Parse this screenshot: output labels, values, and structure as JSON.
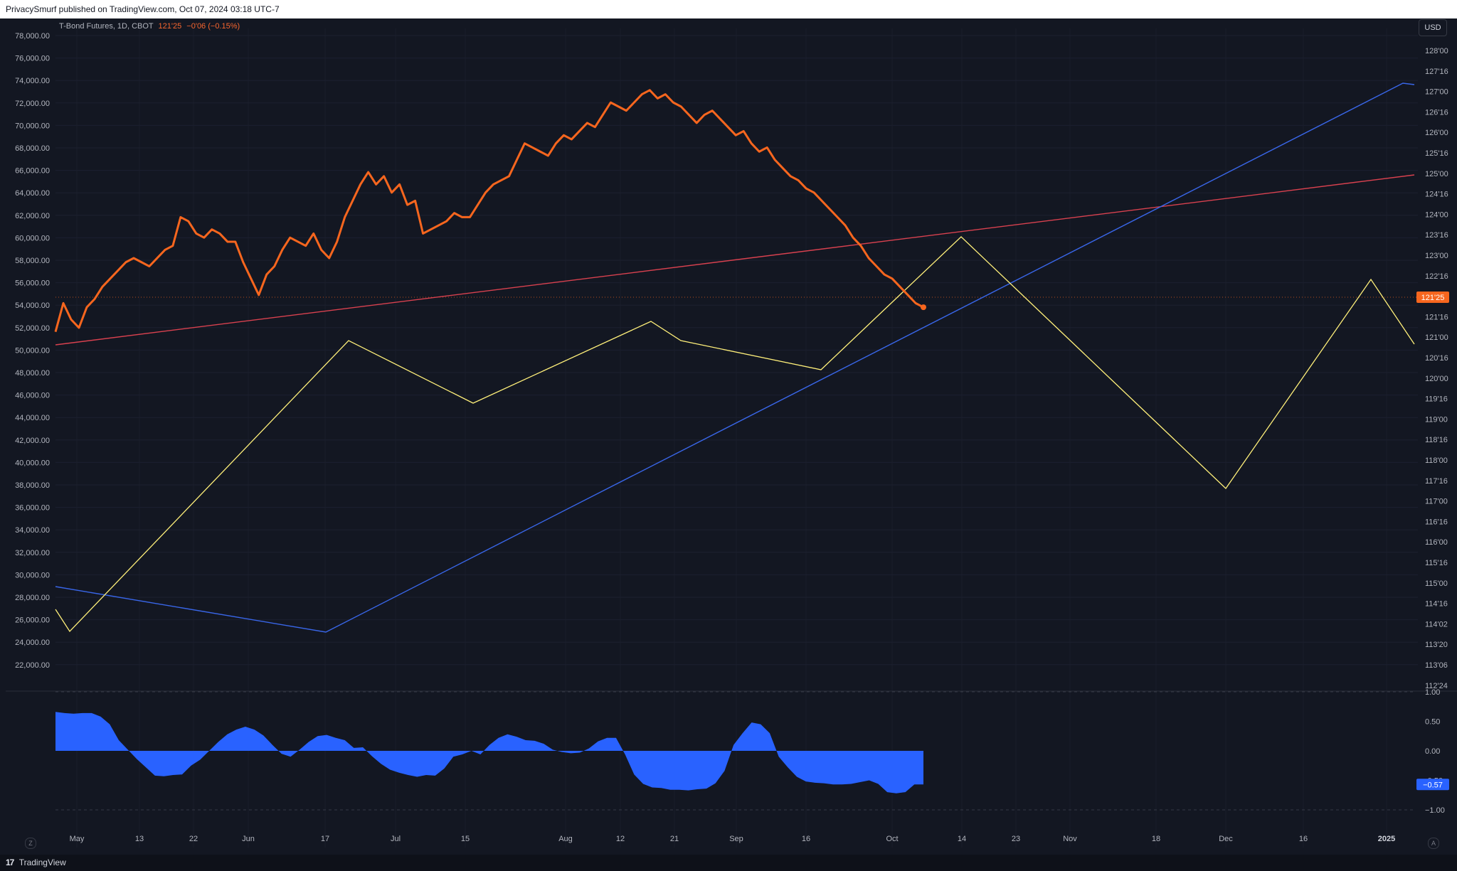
{
  "publisher_bar": "PrivacySmurf published on TradingView.com, Oct 07, 2024 03:18 UTC-7",
  "legend": {
    "symbol": "T-Bond Futures, 1D, CBOT",
    "last": "121'25",
    "change": "−0'06 (−0.15%)"
  },
  "currency_button": "USD",
  "footer": {
    "logo": "17",
    "brand": "TradingView"
  },
  "corner_buttons": {
    "left": "Z",
    "right": "A"
  },
  "colors": {
    "background": "#131722",
    "price_line": "#f7661e",
    "yellow_line": "#fff07a",
    "red_line": "#d9414f",
    "blue_line": "#3966e8",
    "oscillator": "#2962ff"
  },
  "chart_data": {
    "type": "line",
    "time_axis_labels": [
      "May",
      "13",
      "22",
      "Jun",
      "17",
      "Jul",
      "15",
      "Aug",
      "12",
      "21",
      "Sep",
      "16",
      "Oct",
      "14",
      "23",
      "Nov",
      "18",
      "Dec",
      "16",
      "2025"
    ],
    "left_axis": {
      "ticks": [
        "78,000.00",
        "76,000.00",
        "74,000.00",
        "72,000.00",
        "70,000.00",
        "68,000.00",
        "66,000.00",
        "64,000.00",
        "62,000.00",
        "60,000.00",
        "58,000.00",
        "56,000.00",
        "54,000.00",
        "52,000.00",
        "50,000.00",
        "48,000.00",
        "46,000.00",
        "44,000.00",
        "42,000.00",
        "40,000.00",
        "38,000.00",
        "36,000.00",
        "34,000.00",
        "32,000.00",
        "30,000.00",
        "28,000.00",
        "26,000.00",
        "24,000.00",
        "22,000.00"
      ],
      "range": [
        21000,
        79000
      ]
    },
    "right_axis": {
      "ticks": [
        "128'00",
        "127'16",
        "127'00",
        "126'16",
        "126'00",
        "125'16",
        "125'00",
        "124'16",
        "124'00",
        "123'16",
        "123'00",
        "122'16",
        "122'00",
        "121'16",
        "121'00",
        "120'16",
        "120'00",
        "119'16",
        "119'00",
        "118'16",
        "118'00",
        "117'16",
        "117'00",
        "116'16",
        "116'00",
        "115'16",
        "115'00",
        "114'16",
        "114'02",
        "113'20",
        "113'06",
        "112'24"
      ],
      "current_price_label": "121'25"
    },
    "series": [
      {
        "name": "T-Bond Futures",
        "values": [
          [
            0,
            121.2
          ],
          [
            1,
            121.9
          ],
          [
            2,
            121.5
          ],
          [
            3,
            121.3
          ],
          [
            4,
            121.8
          ],
          [
            5,
            122.0
          ],
          [
            6,
            122.3
          ],
          [
            7,
            122.5
          ],
          [
            8,
            122.7
          ],
          [
            9,
            122.9
          ],
          [
            10,
            123.0
          ],
          [
            11,
            122.9
          ],
          [
            12,
            122.8
          ],
          [
            13,
            123.0
          ],
          [
            14,
            123.2
          ],
          [
            15,
            123.3
          ],
          [
            16,
            124.0
          ],
          [
            17,
            123.9
          ],
          [
            18,
            123.6
          ],
          [
            19,
            123.5
          ],
          [
            20,
            123.7
          ],
          [
            21,
            123.6
          ],
          [
            22,
            123.4
          ],
          [
            23,
            123.4
          ],
          [
            24,
            122.9
          ],
          [
            25,
            122.5
          ],
          [
            26,
            122.1
          ],
          [
            27,
            122.6
          ],
          [
            28,
            122.8
          ],
          [
            29,
            123.2
          ],
          [
            30,
            123.5
          ],
          [
            31,
            123.4
          ],
          [
            32,
            123.3
          ],
          [
            33,
            123.6
          ],
          [
            34,
            123.2
          ],
          [
            35,
            123.0
          ],
          [
            36,
            123.4
          ],
          [
            37,
            124.0
          ],
          [
            38,
            124.4
          ],
          [
            39,
            124.8
          ],
          [
            40,
            125.1
          ],
          [
            41,
            124.8
          ],
          [
            42,
            125.0
          ],
          [
            43,
            124.6
          ],
          [
            44,
            124.8
          ],
          [
            45,
            124.3
          ],
          [
            46,
            124.4
          ],
          [
            47,
            123.6
          ],
          [
            48,
            123.7
          ],
          [
            49,
            123.8
          ],
          [
            50,
            123.9
          ],
          [
            51,
            124.1
          ],
          [
            52,
            124.0
          ],
          [
            53,
            124.0
          ],
          [
            54,
            124.3
          ],
          [
            55,
            124.6
          ],
          [
            56,
            124.8
          ],
          [
            57,
            124.9
          ],
          [
            58,
            125.0
          ],
          [
            59,
            125.4
          ],
          [
            60,
            125.8
          ],
          [
            61,
            125.7
          ],
          [
            62,
            125.6
          ],
          [
            63,
            125.5
          ],
          [
            64,
            125.8
          ],
          [
            65,
            126.0
          ],
          [
            66,
            125.9
          ],
          [
            67,
            126.1
          ],
          [
            68,
            126.3
          ],
          [
            69,
            126.2
          ],
          [
            70,
            126.5
          ],
          [
            71,
            126.8
          ],
          [
            72,
            126.7
          ],
          [
            73,
            126.6
          ],
          [
            74,
            126.8
          ],
          [
            75,
            127.0
          ],
          [
            76,
            127.1
          ],
          [
            77,
            126.9
          ],
          [
            78,
            127.0
          ],
          [
            79,
            126.8
          ],
          [
            80,
            126.7
          ],
          [
            81,
            126.5
          ],
          [
            82,
            126.3
          ],
          [
            83,
            126.5
          ],
          [
            84,
            126.6
          ],
          [
            85,
            126.4
          ],
          [
            86,
            126.2
          ],
          [
            87,
            126.0
          ],
          [
            88,
            126.1
          ],
          [
            89,
            125.8
          ],
          [
            90,
            125.6
          ],
          [
            91,
            125.7
          ],
          [
            92,
            125.4
          ],
          [
            93,
            125.2
          ],
          [
            94,
            125.0
          ],
          [
            95,
            124.9
          ],
          [
            96,
            124.7
          ],
          [
            97,
            124.6
          ],
          [
            98,
            124.4
          ],
          [
            99,
            124.2
          ],
          [
            100,
            124.0
          ],
          [
            101,
            123.8
          ],
          [
            102,
            123.5
          ],
          [
            103,
            123.3
          ],
          [
            104,
            123.0
          ],
          [
            105,
            122.8
          ],
          [
            106,
            122.6
          ],
          [
            107,
            122.5
          ],
          [
            108,
            122.3
          ],
          [
            109,
            122.1
          ],
          [
            110,
            121.9
          ],
          [
            111,
            121.8
          ]
        ]
      }
    ],
    "oscillator": {
      "axis_ticks": [
        "1.00",
        "0.50",
        "0.00",
        "-0.50",
        "−1.00"
      ],
      "range": [
        -1.15,
        1.15
      ],
      "last_value_label": "−0.57",
      "values": [
        [
          0,
          0.66
        ],
        [
          1,
          0.64
        ],
        [
          2,
          0.63
        ],
        [
          3,
          0.64
        ],
        [
          4,
          0.64
        ],
        [
          5,
          0.58
        ],
        [
          6,
          0.45
        ],
        [
          7,
          0.18
        ],
        [
          8,
          0.02
        ],
        [
          9,
          -0.14
        ],
        [
          10,
          -0.28
        ],
        [
          11,
          -0.42
        ],
        [
          12,
          -0.43
        ],
        [
          13,
          -0.41
        ],
        [
          14,
          -0.4
        ],
        [
          15,
          -0.25
        ],
        [
          16,
          -0.15
        ],
        [
          17,
          0.0
        ],
        [
          18,
          0.15
        ],
        [
          19,
          0.28
        ],
        [
          20,
          0.36
        ],
        [
          21,
          0.41
        ],
        [
          22,
          0.36
        ],
        [
          23,
          0.26
        ],
        [
          24,
          0.1
        ],
        [
          25,
          -0.05
        ],
        [
          26,
          -0.1
        ],
        [
          27,
          0.02
        ],
        [
          28,
          0.15
        ],
        [
          29,
          0.25
        ],
        [
          30,
          0.27
        ],
        [
          31,
          0.22
        ],
        [
          32,
          0.18
        ],
        [
          33,
          0.05
        ],
        [
          34,
          0.06
        ],
        [
          35,
          -0.09
        ],
        [
          36,
          -0.22
        ],
        [
          37,
          -0.32
        ],
        [
          38,
          -0.37
        ],
        [
          39,
          -0.41
        ],
        [
          40,
          -0.44
        ],
        [
          41,
          -0.41
        ],
        [
          42,
          -0.42
        ],
        [
          43,
          -0.3
        ],
        [
          44,
          -0.1
        ],
        [
          45,
          -0.06
        ],
        [
          46,
          0.0
        ],
        [
          47,
          -0.06
        ],
        [
          48,
          0.1
        ],
        [
          49,
          0.22
        ],
        [
          50,
          0.28
        ],
        [
          51,
          0.24
        ],
        [
          52,
          0.18
        ],
        [
          53,
          0.17
        ],
        [
          54,
          0.12
        ],
        [
          55,
          0.02
        ],
        [
          56,
          -0.02
        ],
        [
          57,
          -0.04
        ],
        [
          58,
          -0.03
        ],
        [
          59,
          0.04
        ],
        [
          60,
          0.16
        ],
        [
          61,
          0.22
        ],
        [
          62,
          0.22
        ],
        [
          63,
          -0.06
        ],
        [
          64,
          -0.4
        ],
        [
          65,
          -0.56
        ],
        [
          66,
          -0.62
        ],
        [
          67,
          -0.63
        ],
        [
          68,
          -0.66
        ],
        [
          69,
          -0.66
        ],
        [
          70,
          -0.67
        ],
        [
          71,
          -0.65
        ],
        [
          72,
          -0.64
        ],
        [
          73,
          -0.55
        ],
        [
          74,
          -0.34
        ],
        [
          75,
          0.1
        ],
        [
          76,
          0.3
        ],
        [
          77,
          0.48
        ],
        [
          78,
          0.45
        ],
        [
          79,
          0.3
        ],
        [
          80,
          -0.1
        ],
        [
          81,
          -0.28
        ],
        [
          82,
          -0.44
        ],
        [
          83,
          -0.52
        ],
        [
          84,
          -0.54
        ],
        [
          85,
          -0.55
        ],
        [
          86,
          -0.57
        ],
        [
          87,
          -0.57
        ],
        [
          88,
          -0.56
        ],
        [
          89,
          -0.53
        ],
        [
          90,
          -0.5
        ],
        [
          91,
          -0.56
        ],
        [
          92,
          -0.7
        ],
        [
          93,
          -0.72
        ],
        [
          94,
          -0.7
        ],
        [
          95,
          -0.57
        ],
        [
          96,
          -0.57
        ]
      ]
    },
    "grid": true
  }
}
